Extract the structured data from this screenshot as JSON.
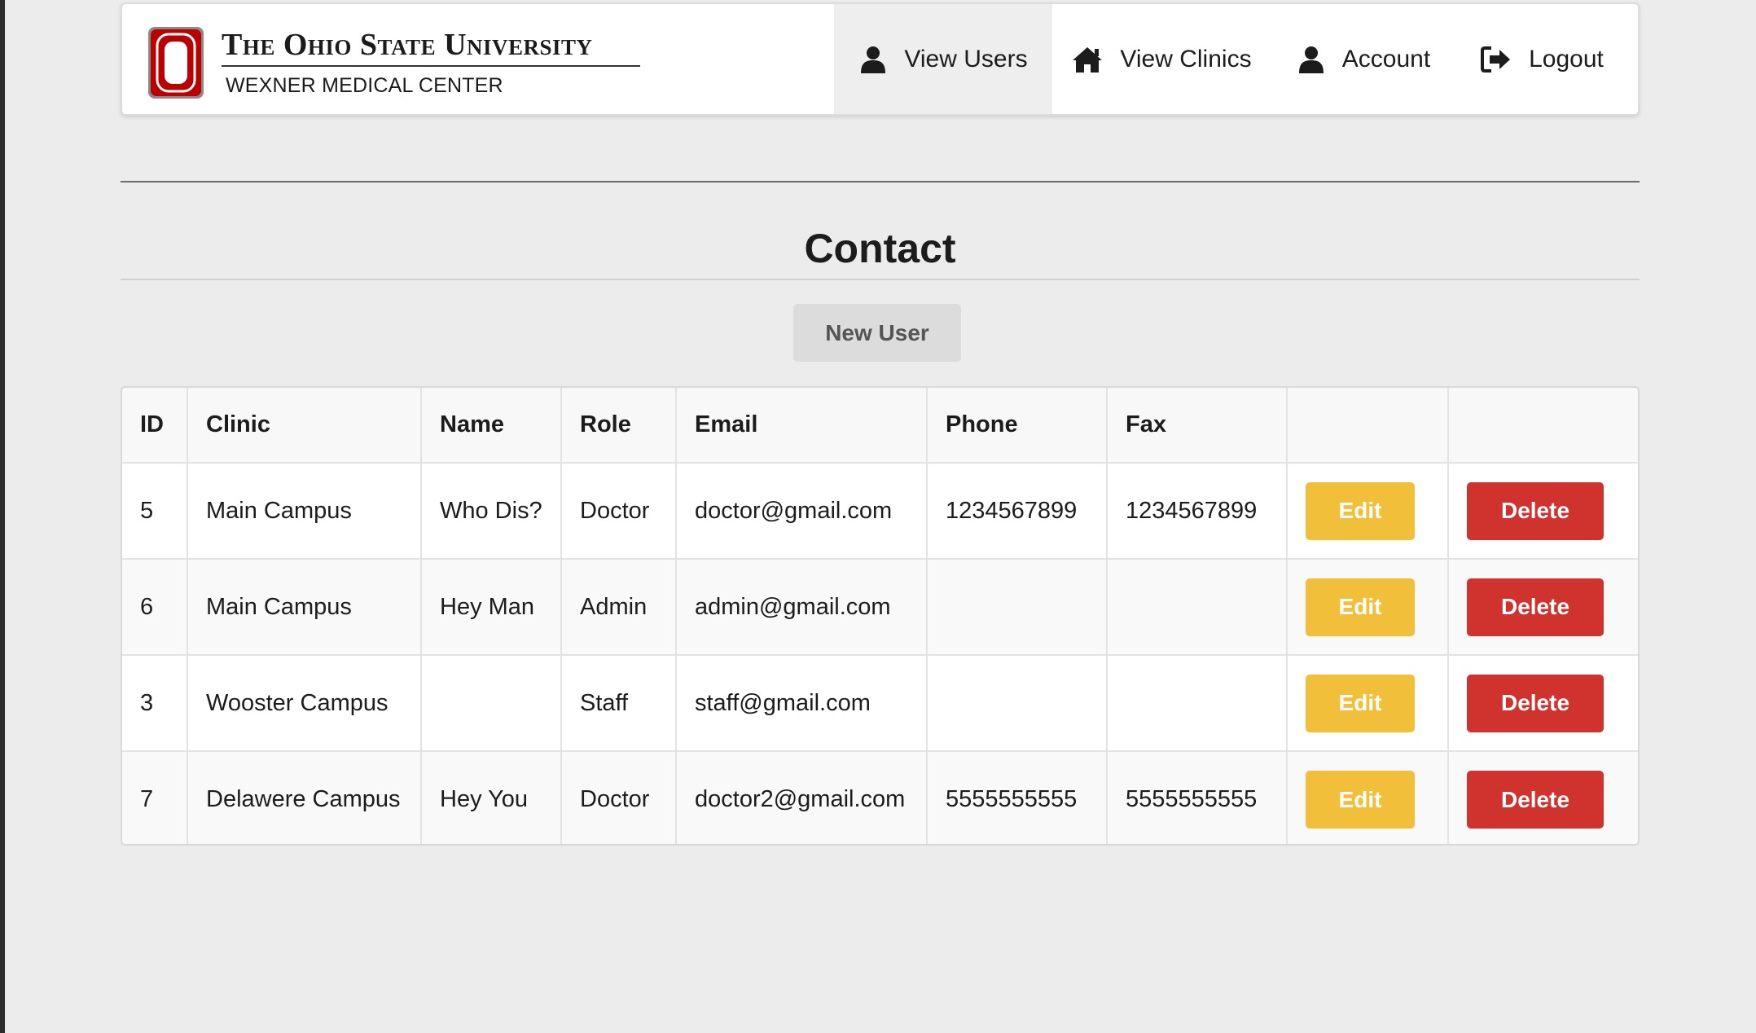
{
  "header": {
    "brand_title": "The Ohio State University",
    "brand_subtitle": "WEXNER MEDICAL CENTER",
    "logo_letter": "O",
    "nav": [
      {
        "label": "View Users",
        "icon": "user-icon",
        "active": true
      },
      {
        "label": "View Clinics",
        "icon": "home-icon",
        "active": false
      },
      {
        "label": "Account",
        "icon": "user-icon",
        "active": false
      },
      {
        "label": "Logout",
        "icon": "sign-out-icon",
        "active": false
      }
    ]
  },
  "main": {
    "title": "Contact",
    "new_user_label": "New User"
  },
  "table": {
    "columns": [
      "ID",
      "Clinic",
      "Name",
      "Role",
      "Email",
      "Phone",
      "Fax",
      "",
      ""
    ],
    "edit_label": "Edit",
    "delete_label": "Delete",
    "rows": [
      {
        "id": "5",
        "clinic": "Main Campus",
        "name": "Who Dis?",
        "role": "Doctor",
        "email": "doctor@gmail.com",
        "phone": "1234567899",
        "fax": "1234567899"
      },
      {
        "id": "6",
        "clinic": "Main Campus",
        "name": "Hey Man",
        "role": "Admin",
        "email": "admin@gmail.com",
        "phone": "",
        "fax": ""
      },
      {
        "id": "3",
        "clinic": "Wooster Campus",
        "name": "",
        "role": "Staff",
        "email": "staff@gmail.com",
        "phone": "",
        "fax": ""
      },
      {
        "id": "7",
        "clinic": "Delawere Campus",
        "name": "Hey You",
        "role": "Doctor",
        "email": "doctor2@gmail.com",
        "phone": "5555555555",
        "fax": "5555555555"
      }
    ]
  },
  "colors": {
    "brand_red": "#bb0000",
    "edit_button": "#f2bf3b",
    "delete_button": "#d0332e",
    "nav_active_bg": "#eeeeee"
  }
}
